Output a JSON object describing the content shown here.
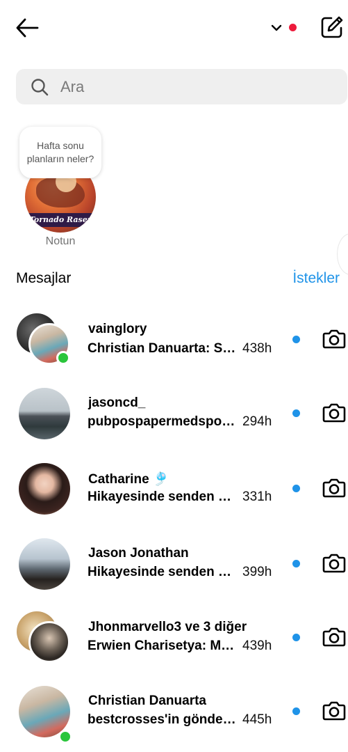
{
  "header": {
    "back_icon": "arrow-left-icon",
    "account_switch_icon": "chevron-down-icon",
    "notification_dot_color": "#ed1a3b",
    "compose_icon": "compose-icon"
  },
  "search": {
    "placeholder": "Ara",
    "icon": "search-icon"
  },
  "note": {
    "bubble_text": "Hafta sonu planların neler?",
    "avatar_caption": "Tornado Rasengan",
    "label": "Notun"
  },
  "messages_section": {
    "title": "Mesajlar",
    "requests_label": "İstekler"
  },
  "colors": {
    "accent_blue": "#1f93e8",
    "online_green": "#2ac53b",
    "unread_blue": "#1f93e8"
  },
  "conversations": [
    {
      "name": "vainglory",
      "preview": "Christian Danuarta: Sticker terkirim",
      "time": "438h",
      "avatar": "group",
      "online": true,
      "unread": true
    },
    {
      "name": "jasoncd_",
      "preview": "pubpospapermedspoke sent",
      "time": "294h",
      "avatar": "single",
      "online": false,
      "unread": true
    },
    {
      "name": "Catharine 🎐",
      "preview": "Hikayesinde senden bahsetti",
      "time": "331h",
      "avatar": "single",
      "online": false,
      "unread": true
    },
    {
      "name": "Jason Jonathan",
      "preview": "Hikayesinde senden bahsetti",
      "time": "399h",
      "avatar": "single",
      "online": false,
      "unread": true
    },
    {
      "name": "Jhonmarvello3 ve 3 diğer",
      "preview": "Erwien Charisetya: Mengirim",
      "time": "439h",
      "avatar": "group",
      "online": false,
      "unread": true
    },
    {
      "name": "Christian Danuarta",
      "preview": "bestcrosses'in gönderisi",
      "time": "445h",
      "avatar": "single",
      "online": true,
      "unread": true
    }
  ]
}
